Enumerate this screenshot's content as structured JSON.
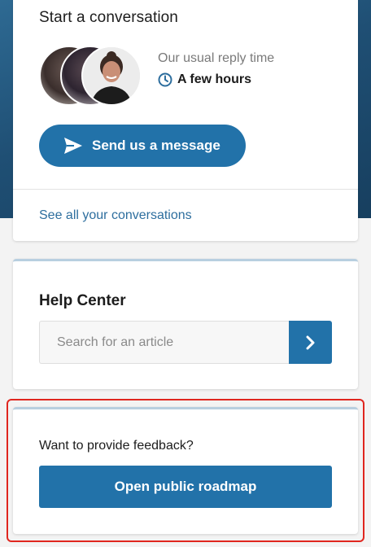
{
  "conversation": {
    "title": "Start a conversation",
    "reply_label": "Our usual reply time",
    "reply_time": "A few hours",
    "send_button": "Send us a message",
    "see_all_link": "See all your conversations"
  },
  "help_center": {
    "title": "Help Center",
    "search_placeholder": "Search for an article",
    "search_value": ""
  },
  "feedback": {
    "prompt": "Want to provide feedback?",
    "roadmap_button": "Open public roadmap"
  },
  "icons": {
    "clock": "clock-icon",
    "send": "paper-plane-icon",
    "search_submit": "chevron-right-icon"
  },
  "colors": {
    "accent": "#2272a9",
    "header_bg": "#1f4f74",
    "link": "#2d6e9e",
    "highlight": "#e0261f"
  }
}
